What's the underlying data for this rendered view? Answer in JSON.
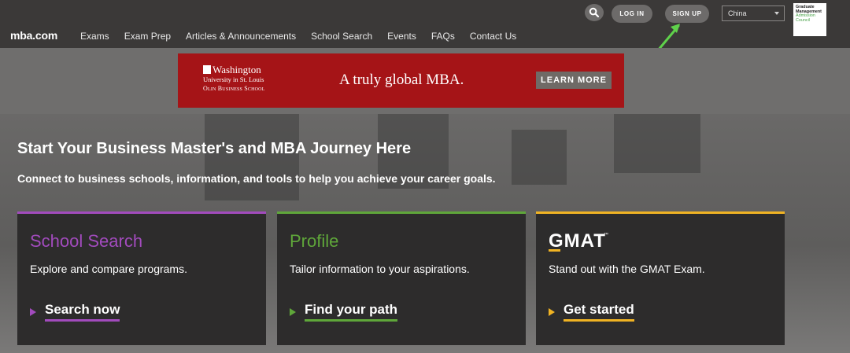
{
  "header": {
    "logo": "mba.com",
    "nav": [
      "Exams",
      "Exam Prep",
      "Articles & Announcements",
      "School Search",
      "Events",
      "FAQs",
      "Contact Us"
    ],
    "login_label": "LOG IN",
    "signup_label": "SIGN UP",
    "country": "China",
    "gmac": [
      "Graduate",
      "Management",
      "Admission",
      "Council"
    ]
  },
  "ad": {
    "logo_line1": "Washington",
    "logo_line2": "University in St. Louis",
    "logo_line3": "Olin Business School",
    "tagline": "A truly global MBA.",
    "button_label": "LEARN MORE"
  },
  "hero": {
    "title": "Start Your Business Master's and MBA Journey Here",
    "subtitle": "Connect to business schools, information, and tools to help you achieve your career goals."
  },
  "cards": [
    {
      "title": "School Search",
      "desc": "Explore and compare programs.",
      "cta": "Search now",
      "accent": "#a24bbd"
    },
    {
      "title": "Profile",
      "desc": "Tailor information to your aspirations.",
      "cta": "Find your path",
      "accent": "#5fa73a"
    },
    {
      "title": "GMAT",
      "desc": "Stand out with the GMAT Exam.",
      "cta": "Get started",
      "accent": "#f0b323"
    }
  ],
  "colors": {
    "header_bg": "#3b3938",
    "ad_red": "#a51417",
    "annotation_arrow": "#5fd14b"
  }
}
